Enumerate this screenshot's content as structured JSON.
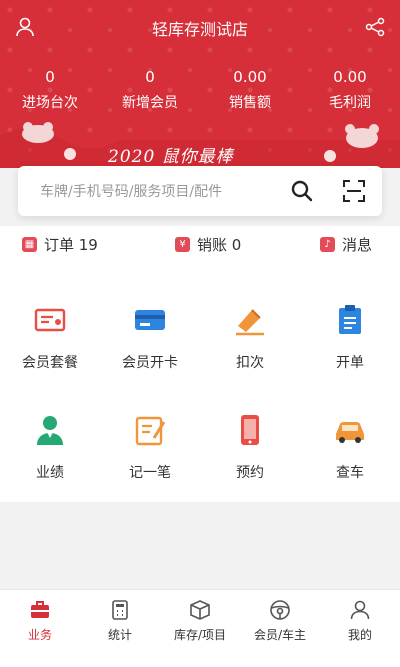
{
  "header": {
    "title": "轻库存测试店",
    "stats": [
      {
        "value": "0",
        "label": "进场台次"
      },
      {
        "value": "0",
        "label": "新增会员"
      },
      {
        "value": "0.00",
        "label": "销售额"
      },
      {
        "value": "0.00",
        "label": "毛利润"
      }
    ],
    "banner": "2020 鼠你最棒"
  },
  "search": {
    "placeholder": "车牌/手机号码/服务项目/配件"
  },
  "quick": {
    "orders": "订单 19",
    "writeoff": "销账 0",
    "messages": "消息"
  },
  "grid": [
    {
      "label": "会员套餐",
      "icon": "membership-package-icon"
    },
    {
      "label": "会员开卡",
      "icon": "member-card-icon"
    },
    {
      "label": "扣次",
      "icon": "deduct-icon"
    },
    {
      "label": "开单",
      "icon": "create-order-icon"
    },
    {
      "label": "业绩",
      "icon": "performance-icon"
    },
    {
      "label": "记一笔",
      "icon": "note-icon"
    },
    {
      "label": "预约",
      "icon": "appointment-icon"
    },
    {
      "label": "查车",
      "icon": "car-search-icon"
    }
  ],
  "tabs": [
    {
      "label": "业务",
      "active": true
    },
    {
      "label": "统计"
    },
    {
      "label": "库存/项目"
    },
    {
      "label": "会员/车主"
    },
    {
      "label": "我的"
    }
  ],
  "colors": {
    "brand": "#d62f39",
    "orange": "#f0963a",
    "blue": "#2e85e0"
  }
}
